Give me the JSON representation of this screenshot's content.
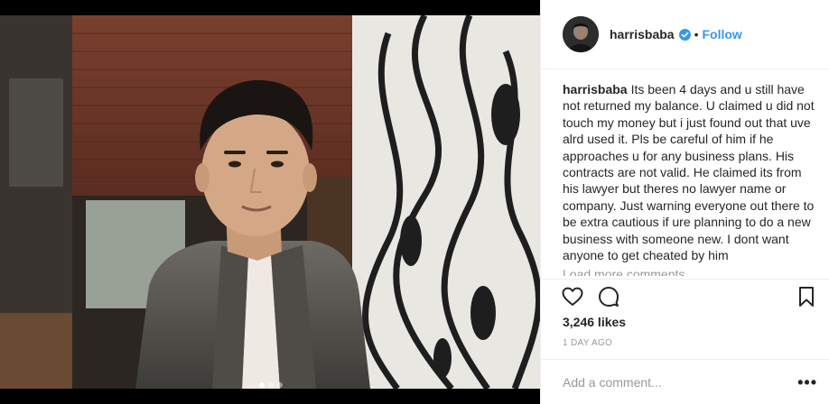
{
  "post": {
    "username": "harrisbaba",
    "verified": true,
    "separator": "•",
    "follow_label": "Follow",
    "caption_text": "Its been 4 days and u still have not returned my balance. U claimed u did not touch my money but i just found out that uve alrd used it. Pls be careful of him if he approaches u for any business plans. His contracts are not valid. He claimed its from his lawyer but theres no lawyer name or company. Just warning everyone out there to be extra cautious if ure planning to do a new business with someone new. I dont want anyone to get cheated by him",
    "load_more_label": "Load more comments",
    "likes": "3,246 likes",
    "time_ago": "1 DAY AGO",
    "comment_placeholder": "Add a comment...",
    "more_label": "•••"
  },
  "carousel": {
    "total": 3,
    "active_index": 0
  },
  "icons": {
    "like": "heart-icon",
    "comment": "comment-icon",
    "save": "bookmark-icon",
    "verified": "verified-badge-icon"
  },
  "colors": {
    "accent": "#3897f0",
    "text": "#262626",
    "muted": "#999999",
    "border": "#efefef"
  }
}
